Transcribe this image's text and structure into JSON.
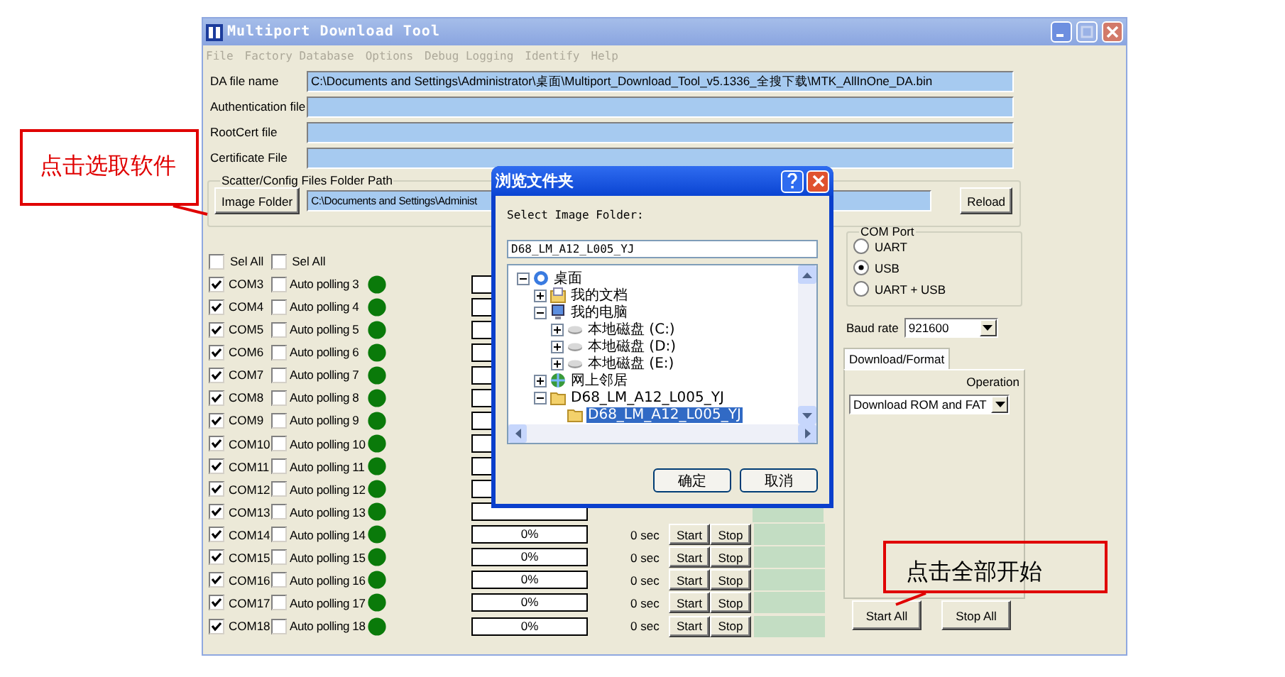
{
  "window": {
    "title": "Multiport Download Tool"
  },
  "menu": [
    {
      "label": "File",
      "disabled": true
    },
    {
      "label": "Factory Database",
      "disabled": true
    },
    {
      "label": "Options",
      "disabled": true
    },
    {
      "label": "Debug Logging",
      "disabled": true
    },
    {
      "label": "Identify",
      "disabled": true
    },
    {
      "label": "Help",
      "disabled": true
    }
  ],
  "file_fields": [
    {
      "label": "DA file name",
      "value": "C:\\Documents and Settings\\Administrator\\桌面\\Multiport_Download_Tool_v5.1336_全搜下载\\MTK_AllInOne_DA.bin"
    },
    {
      "label": "Authentication file"
    },
    {
      "label": "RootCert file"
    },
    {
      "label": "Certificate File"
    }
  ],
  "scatter": {
    "legend": "Scatter/Config Files Folder Path",
    "button": "Image Folder",
    "value": "C:\\Documents and Settings\\Administ",
    "reload": "Reload"
  },
  "select_all": [
    {
      "label": "Sel All",
      "checked": false
    },
    {
      "label": "Sel All",
      "checked": false
    }
  ],
  "ports": [
    {
      "com": "COM3",
      "com_checked": true,
      "auto": "Auto polling 3",
      "auto_checked": false,
      "level": 0
    },
    {
      "com": "COM4",
      "com_checked": true,
      "auto": "Auto polling 4",
      "auto_checked": false,
      "level": 0
    },
    {
      "com": "COM5",
      "com_checked": true,
      "auto": "Auto polling 5",
      "auto_checked": false,
      "level": 0
    },
    {
      "com": "COM6",
      "com_checked": true,
      "auto": "Auto polling 6",
      "auto_checked": false,
      "level": 0
    },
    {
      "com": "COM7",
      "com_checked": true,
      "auto": "Auto polling 7",
      "auto_checked": false,
      "level": 0
    },
    {
      "com": "COM8",
      "com_checked": true,
      "auto": "Auto polling 8",
      "auto_checked": false,
      "level": 0
    },
    {
      "com": "COM9",
      "com_checked": true,
      "auto": "Auto polling 9",
      "auto_checked": false,
      "level": 0
    },
    {
      "com": "COM10",
      "com_checked": true,
      "auto": "Auto polling 10",
      "auto_checked": false,
      "level": 0
    },
    {
      "com": "COM11",
      "com_checked": true,
      "auto": "Auto polling 11",
      "auto_checked": false,
      "level": 0
    },
    {
      "com": "COM12",
      "com_checked": true,
      "auto": "Auto polling 12",
      "auto_checked": false,
      "level": 0
    },
    {
      "com": "COM13",
      "com_checked": true,
      "auto": "Auto polling 13",
      "auto_checked": false,
      "level": 0
    },
    {
      "com": "COM14",
      "com_checked": true,
      "auto": "Auto polling 14",
      "auto_checked": false,
      "level": 0,
      "progress": "0%",
      "time": "0 sec",
      "start": "Start",
      "stop": "Stop"
    },
    {
      "com": "COM15",
      "com_checked": true,
      "auto": "Auto polling 15",
      "auto_checked": false,
      "level": 0,
      "progress": "0%",
      "time": "0 sec",
      "start": "Start",
      "stop": "Stop"
    },
    {
      "com": "COM16",
      "com_checked": true,
      "auto": "Auto polling 16",
      "auto_checked": false,
      "level": 0,
      "progress": "0%",
      "time": "0 sec",
      "start": "Start",
      "stop": "Stop"
    },
    {
      "com": "COM17",
      "com_checked": true,
      "auto": "Auto polling 17",
      "auto_checked": false,
      "level": 0,
      "progress": "0%",
      "time": "0 sec",
      "start": "Start",
      "stop": "Stop"
    },
    {
      "com": "COM18",
      "com_checked": true,
      "auto": "Auto polling 18",
      "auto_checked": false,
      "level": 0,
      "progress": "0%",
      "time": "0 sec",
      "start": "Start",
      "stop": "Stop"
    }
  ],
  "com_port": {
    "legend": "COM Port",
    "options": [
      {
        "label": "UART",
        "selected": false
      },
      {
        "label": "USB",
        "selected": true
      },
      {
        "label": "UART + USB",
        "selected": false
      }
    ]
  },
  "baud": {
    "label": "Baud rate",
    "value": "921600"
  },
  "tabs": [
    {
      "label": "Download/Format",
      "selected": true
    }
  ],
  "operation": {
    "label": "Operation",
    "value": "Download ROM and FAT"
  },
  "actions": [
    "Start All",
    "Stop All"
  ],
  "dialog": {
    "title": "浏览文件夹",
    "prompt": "Select Image Folder:",
    "value": "D68_LM_A12_L005_YJ",
    "tree": [
      {
        "label": "桌面",
        "kind": "desktop",
        "expanded": true,
        "selected": false,
        "children": [
          {
            "label": "我的文档",
            "kind": "documents",
            "expanded": false,
            "selected": false
          },
          {
            "label": "我的电脑",
            "kind": "computer",
            "expanded": true,
            "selected": false,
            "children": [
              {
                "label": "本地磁盘 (C:)",
                "kind": "disk",
                "expanded": false,
                "selected": false
              },
              {
                "label": "本地磁盘 (D:)",
                "kind": "disk",
                "expanded": false,
                "selected": false
              },
              {
                "label": "本地磁盘 (E:)",
                "kind": "disk",
                "expanded": false,
                "selected": false
              }
            ]
          },
          {
            "label": "网上邻居",
            "kind": "network",
            "expanded": false,
            "selected": false
          },
          {
            "label": "D68_LM_A12_L005_YJ",
            "kind": "folder",
            "expanded": true,
            "selected": false,
            "children": [
              {
                "label": "D68_LM_A12_L005_YJ",
                "kind": "folder",
                "selected": true
              }
            ]
          }
        ]
      }
    ],
    "buttons": [
      "确定",
      "取消"
    ]
  },
  "annotations": [
    {
      "text": "点击选取软件"
    },
    {
      "text": "点击全部开始"
    }
  ]
}
